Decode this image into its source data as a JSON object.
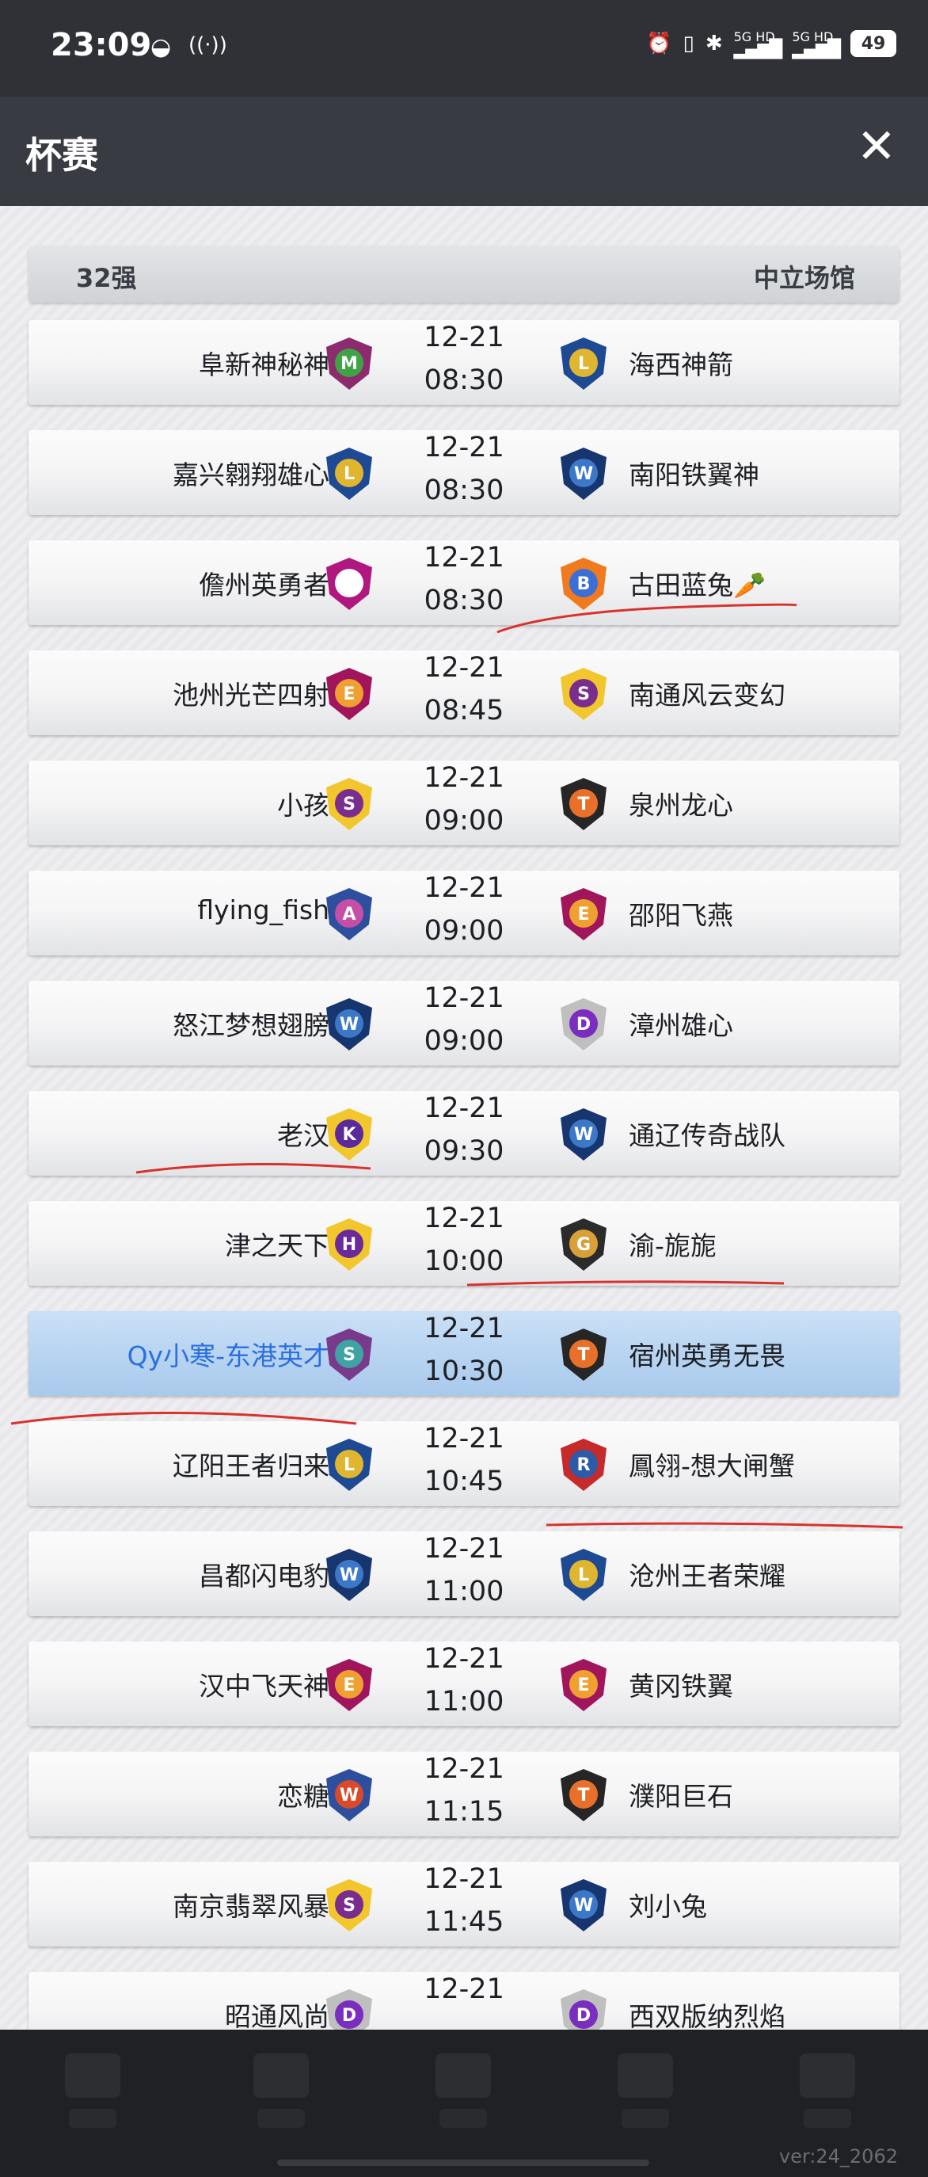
{
  "status_bar": {
    "time": "23:09",
    "wechat_icon": "wechat-icon",
    "hotspot_icon": "hotspot-icon",
    "signal_labels": [
      "5G HD",
      "5G HD"
    ],
    "battery": "49"
  },
  "header": {
    "title": "杯赛",
    "close_label": "✕"
  },
  "section": {
    "round": "32强",
    "venue": "中立场馆"
  },
  "colors": {
    "highlight_row": "#b8d4f1",
    "highlight_text": "#2b6fe0",
    "pen_mark": "#d8322e"
  },
  "matches": [
    {
      "home": "阜新神秘神",
      "home_logo": "green-mystery-logo",
      "date": "12-21",
      "time": "08:30",
      "away": "海西神箭",
      "away_logo": "gold-lion-logo"
    },
    {
      "home": "嘉兴翱翔雄心",
      "home_logo": "gold-lion-logo",
      "date": "12-21",
      "time": "08:30",
      "away": "南阳铁翼神",
      "away_logo": "blue-wolf-logo"
    },
    {
      "home": "儋州英勇者",
      "home_logo": "purple-panda-logo",
      "date": "12-21",
      "time": "08:30",
      "away": "古田蓝兔🥕",
      "away_logo": "orange-bunny-logo"
    },
    {
      "home": "池州光芒四射",
      "home_logo": "magenta-eagle-logo",
      "date": "12-21",
      "time": "08:45",
      "away": "南通风云变幻",
      "away_logo": "spartan-shield-logo"
    },
    {
      "home": "小孩",
      "home_logo": "spartan-shield-logo",
      "date": "12-21",
      "time": "09:00",
      "away": "泉州龙心",
      "away_logo": "tiger-shield-logo"
    },
    {
      "home": "flying_fish",
      "home_logo": "anime-avatar-logo",
      "date": "12-21",
      "time": "09:00",
      "away": "邵阳飞燕",
      "away_logo": "magenta-eagle-logo"
    },
    {
      "home": "怒江梦想翅膀",
      "home_logo": "blue-wolf-logo",
      "date": "12-21",
      "time": "09:00",
      "away": "漳州雄心",
      "away_logo": "purple-dragon-logo"
    },
    {
      "home": "老汉",
      "home_logo": "basketball-logo",
      "date": "12-21",
      "time": "09:30",
      "away": "通辽传奇战队",
      "away_logo": "blue-wolf-logo"
    },
    {
      "home": "津之天下",
      "home_logo": "purple-horse-logo",
      "date": "12-21",
      "time": "10:00",
      "away": "渝-旎旎",
      "away_logo": "bulldog-logo"
    },
    {
      "home": "Qy小寒-东港英才",
      "home_logo": "spartan-purple-logo",
      "date": "12-21",
      "time": "10:30",
      "away": "宿州英勇无畏",
      "away_logo": "tiger-shield-logo",
      "highlight": true
    },
    {
      "home": "辽阳王者归来",
      "home_logo": "gold-lion-logo",
      "date": "12-21",
      "time": "10:45",
      "away": "鳳翎-想大闸蟹",
      "away_logo": "red-eagle-logo"
    },
    {
      "home": "昌都闪电豹",
      "home_logo": "blue-wolf-logo",
      "date": "12-21",
      "time": "11:00",
      "away": "沧州王者荣耀",
      "away_logo": "gold-lion-logo"
    },
    {
      "home": "汉中飞天神",
      "home_logo": "magenta-eagle-logo",
      "date": "12-21",
      "time": "11:00",
      "away": "黄冈铁翼",
      "away_logo": "magenta-eagle-logo"
    },
    {
      "home": "恋糖",
      "home_logo": "red-wolf-logo",
      "date": "12-21",
      "time": "11:15",
      "away": "濮阳巨石",
      "away_logo": "tiger-shield-logo"
    },
    {
      "home": "南京翡翠风暴",
      "home_logo": "spartan-shield-logo",
      "date": "12-21",
      "time": "11:45",
      "away": "刘小兔",
      "away_logo": "blue-wolf-logo"
    },
    {
      "home": "昭通风尚",
      "home_logo": "purple-dragon-logo",
      "date": "12-21",
      "time": "",
      "away": "西双版纳烈焰",
      "away_logo": "purple-dragon-logo"
    }
  ],
  "bottom_nav": {
    "items": [
      "nav-item-1",
      "nav-item-2",
      "nav-item-3",
      "nav-item-4",
      "nav-item-5"
    ]
  },
  "version": "ver:24_2062"
}
